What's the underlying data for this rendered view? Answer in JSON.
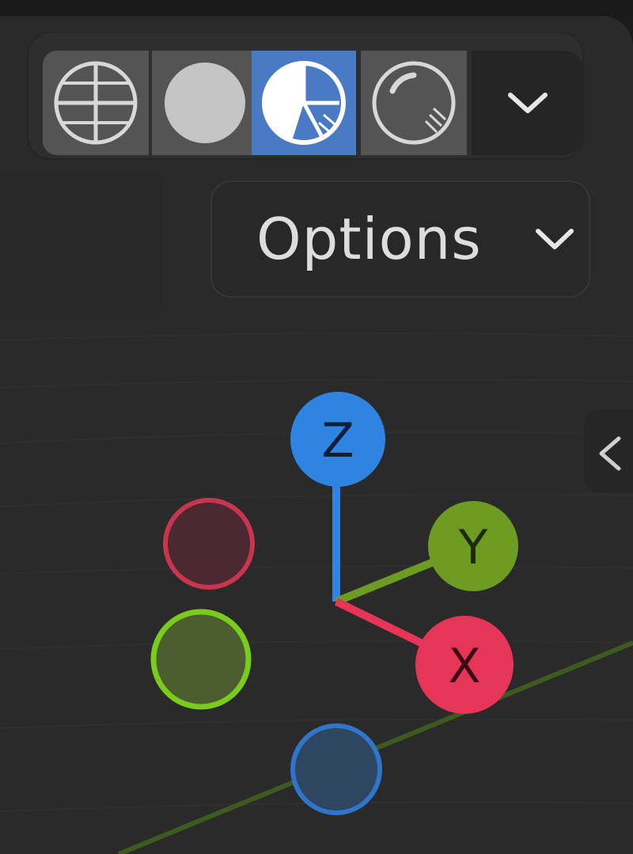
{
  "shading": {
    "modes": [
      {
        "name": "wireframe",
        "icon": "wireframe-sphere-icon",
        "active": false
      },
      {
        "name": "solid",
        "icon": "solid-sphere-icon",
        "active": false
      },
      {
        "name": "material-preview",
        "icon": "material-preview-sphere-icon",
        "active": true
      },
      {
        "name": "rendered",
        "icon": "rendered-sphere-icon",
        "active": false
      }
    ],
    "dropdown_icon": "chevron-down-icon"
  },
  "options": {
    "label": "Options",
    "icon": "chevron-down-icon"
  },
  "sidebar_toggle": {
    "icon": "chevron-left-icon"
  },
  "gizmo": {
    "axes": [
      {
        "label": "Z",
        "color": "#2f84e2",
        "positive": true
      },
      {
        "label": "Y",
        "color": "#6e9c22",
        "positive": true
      },
      {
        "label": "X",
        "color": "#e63556",
        "positive": true
      }
    ],
    "negative_colors": {
      "x": "#c9344e",
      "y": "#7acc1c",
      "z": "#2f75c9"
    }
  },
  "colors": {
    "viewport_bg": "#2a2a2a",
    "active_button": "#4a7ac3",
    "grid_line": "#2f2f2f",
    "y_axis_line": "#3f5a1e"
  }
}
